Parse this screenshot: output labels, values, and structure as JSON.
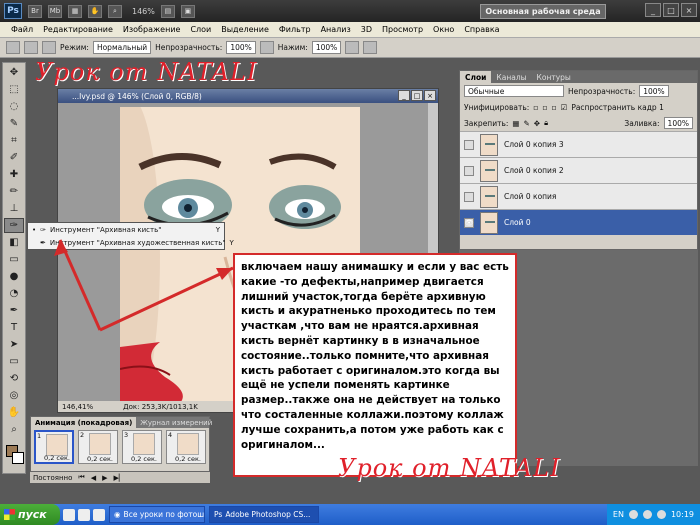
{
  "appbar": {
    "logo": "Ps",
    "zoom": "146%",
    "workspace_button": "Основная рабочая среда",
    "window_controls": [
      "_",
      "□",
      "×"
    ]
  },
  "menubar": {
    "items": [
      "Файл",
      "Редактирование",
      "Изображение",
      "Слои",
      "Выделение",
      "Фильтр",
      "Анализ",
      "3D",
      "Просмотр",
      "Окно",
      "Справка"
    ]
  },
  "options": {
    "mode_label": "Режим:",
    "mode_value": "Нормальный",
    "opacity_label": "Непрозрачность:",
    "opacity_value": "100%",
    "pressure_label": "Нажим:",
    "pressure_value": "100%"
  },
  "flyout": {
    "items": [
      {
        "label": "Инструмент \"Архивная кисть\"",
        "key": "Y"
      },
      {
        "label": "Инструмент \"Архивная художественная кисть\"",
        "key": "Y"
      }
    ]
  },
  "document": {
    "title": "...Ivy.psd @ 146% (Слой 0, RGB/8)",
    "zoom": "146,41%",
    "doc_info": "Док: 253,3K/1013,1K"
  },
  "layers": {
    "tabs": [
      "Слои",
      "Каналы",
      "Контуры"
    ],
    "blend_mode": "Обычные",
    "opacity_label": "Непрозрачность:",
    "opacity_value": "100%",
    "unify_label": "Унифицировать:",
    "propagate_label": "Распространить кадр 1",
    "lock_label": "Закрепить:",
    "fill_label": "Заливка:",
    "fill_value": "100%",
    "items": [
      "Слой 0 копия 3",
      "Слой 0 копия 2",
      "Слой 0 копия",
      "Слой 0"
    ]
  },
  "animation": {
    "tabs": [
      "Анимация (покадровая)",
      "Журнал измерений"
    ],
    "frames": [
      {
        "n": "1",
        "dur": "0,2 сек."
      },
      {
        "n": "2",
        "dur": "0,2 сек."
      },
      {
        "n": "3",
        "dur": "0,2 сек."
      },
      {
        "n": "4",
        "dur": "0,2 сек."
      }
    ],
    "loop": "Постоянно"
  },
  "note": {
    "text": "включаем нашу анимашку и если у вас есть какие -то дефекты,например двигается  лишний участок,тогда берёте архивную кисть и акуратненько проходитесь по тем участкам ,что вам не нраятся.архивная кисть вернёт картинку в в изначальное состояние..только помните,что архивная кисть работает с оригиналом.это когда вы ещё не успели поменять картинке размер..также она не действует на только что состаленные коллажи.поэтому коллаж лучше сохранить,а потом уже  работь как с оригиналом..."
  },
  "watermark": "Урок от NATALI",
  "taskbar": {
    "start": "пуск",
    "tasks": [
      "Все уроки по фотош...",
      "Adobe Photoshop CS..."
    ],
    "lang": "EN",
    "clock": "10:19"
  },
  "colors": {
    "note_border": "#d42a2a",
    "watermark": "#e0202a",
    "layer_selected": "#3a5fa8",
    "taskbar": "#1f5ec8"
  }
}
